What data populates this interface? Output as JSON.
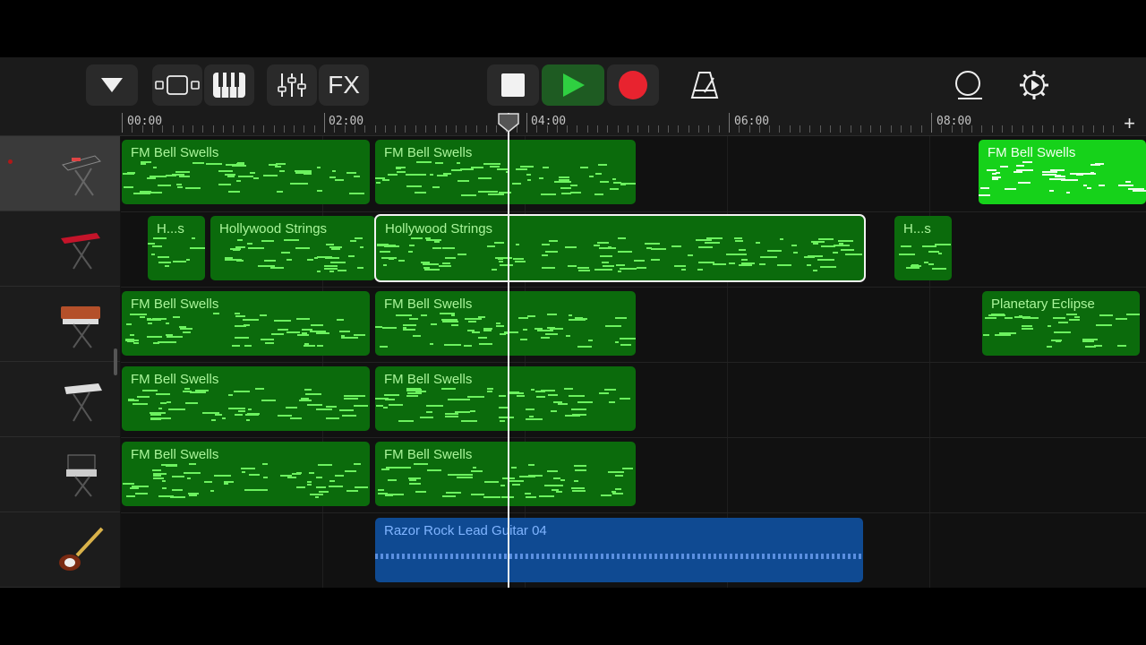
{
  "toolbar": {
    "fx_label": "FX",
    "icons": [
      "dropdown-triangle-icon",
      "view-toggle-icon",
      "keyboard-icon",
      "mixer-icon",
      "stop-icon",
      "play-icon",
      "record-icon",
      "metronome-icon",
      "loop-icon",
      "settings-icon"
    ],
    "colors": {
      "play": "#27c93f",
      "record": "#e8232f"
    }
  },
  "ruler": {
    "labels": [
      "00:00",
      "02:00",
      "04:00",
      "06:00",
      "08:00"
    ],
    "add_label": "+"
  },
  "tracks": [
    {
      "instrument": "synth-keyboard-stand-icon",
      "selected": true
    },
    {
      "instrument": "red-keyboard-icon",
      "selected": false
    },
    {
      "instrument": "vintage-synth-icon",
      "selected": false
    },
    {
      "instrument": "white-keyboard-icon",
      "selected": false
    },
    {
      "instrument": "modular-synth-icon",
      "selected": false
    },
    {
      "instrument": "electric-guitar-icon",
      "selected": false
    }
  ],
  "regions": {
    "r0a": "FM Bell Swells",
    "r0b": "FM Bell Swells",
    "r0c": "FM Bell Swells",
    "r1a": "H...s",
    "r1b": "Hollywood Strings",
    "r1c": "Hollywood Strings",
    "r1d": "H...s",
    "r2a": "FM Bell Swells",
    "r2b": "FM Bell Swells",
    "r2c": "Planetary Eclipse",
    "r3a": "FM Bell Swells",
    "r3b": "FM Bell Swells",
    "r4a": "FM Bell Swells",
    "r4b": "FM Bell Swells",
    "r5a": "Razor Rock Lead Guitar 04"
  },
  "colors": {
    "midi_region": "#0b6b0c",
    "selected_midi_region": "#16d21a",
    "audio_region": "#0f4a92",
    "notes": "#6cf25f"
  }
}
